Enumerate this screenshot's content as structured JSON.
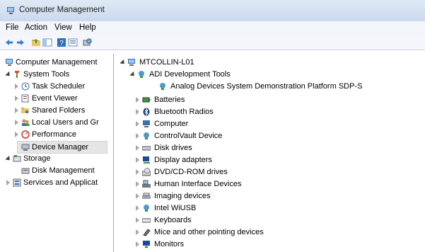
{
  "window": {
    "title": "Computer Management"
  },
  "menu": {
    "file": "File",
    "action": "Action",
    "view": "View",
    "help": "Help"
  },
  "toolbar": {
    "icons": [
      "back-arrow-icon",
      "forward-arrow-icon",
      "folder-up-icon",
      "show-hide-tree-icon",
      "help-icon",
      "properties-icon",
      "scan-hardware-icon"
    ]
  },
  "left_tree": {
    "root": "Computer Management",
    "system_tools": "System Tools",
    "task_scheduler": "Task Scheduler",
    "event_viewer": "Event Viewer",
    "shared_folders": "Shared Folders",
    "local_users": "Local Users and Gr",
    "performance": "Performance",
    "device_manager": "Device Manager",
    "storage": "Storage",
    "disk_management": "Disk Management",
    "services": "Services and Applicat"
  },
  "device_tree": {
    "computer": "MTCOLLIN-L01",
    "adi_tools": "ADI Development Tools",
    "adi_device": "Analog Devices System Demonstration Platform SDP-S",
    "categories": [
      "Batteries",
      "Bluetooth Radios",
      "Computer",
      "ControlVault Device",
      "Disk drives",
      "Display adapters",
      "DVD/CD-ROM drives",
      "Human Interface Devices",
      "Imaging devices",
      "Intel WiUSB",
      "Keyboards",
      "Mice and other pointing devices",
      "Monitors"
    ]
  }
}
